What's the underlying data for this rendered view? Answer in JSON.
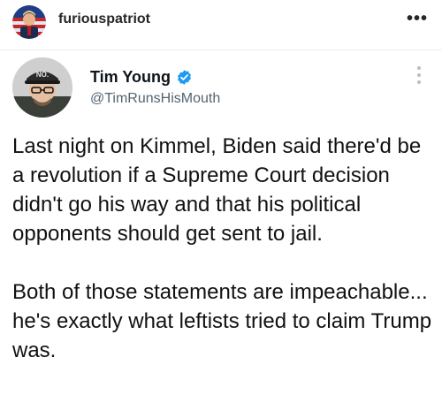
{
  "post": {
    "username": "furiouspatriot",
    "more_icon": "more-horizontal-icon"
  },
  "tweet": {
    "display_name": "Tim Young",
    "handle": "@TimRunsHisMouth",
    "verified": true,
    "avatar_cap_text": "NO.",
    "paragraphs": [
      "Last night on Kimmel, Biden said there'd be a revolution if a Supreme Court decision didn't go his way and that his political opponents should get sent to jail.",
      "Both of those statements are impeachable... he's exactly what leftists tried to claim Trump was."
    ]
  },
  "colors": {
    "verified": "#1d9bf0",
    "handle": "#536471",
    "text": "#0f1419"
  }
}
